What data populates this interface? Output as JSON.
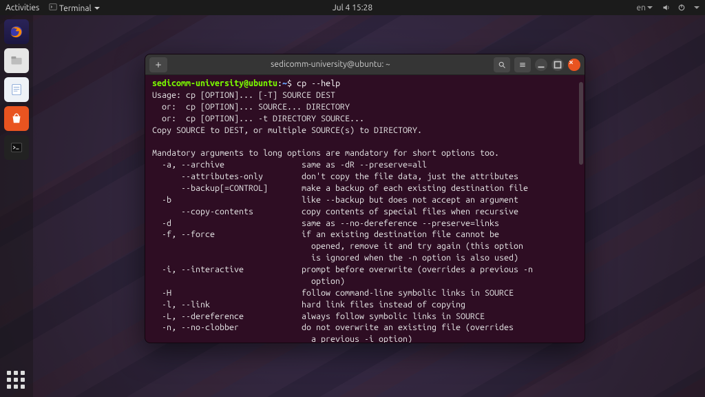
{
  "topbar": {
    "activities": "Activities",
    "app_menu": "Terminal",
    "clock": "Jul 4  15:28",
    "lang": "en"
  },
  "dock": {
    "items": [
      {
        "name": "firefox"
      },
      {
        "name": "files"
      },
      {
        "name": "writer"
      },
      {
        "name": "software"
      },
      {
        "name": "terminal"
      }
    ]
  },
  "terminal": {
    "window_title": "sedicomm-university@ubuntu: ~",
    "prompt_user": "sedicomm-university@ubuntu",
    "prompt_path": "~",
    "prompt_sep": ":",
    "prompt_end": "$ ",
    "command": "cp --help",
    "output": "Usage: cp [OPTION]... [-T] SOURCE DEST\n  or:  cp [OPTION]... SOURCE... DIRECTORY\n  or:  cp [OPTION]... -t DIRECTORY SOURCE...\nCopy SOURCE to DEST, or multiple SOURCE(s) to DIRECTORY.\n\nMandatory arguments to long options are mandatory for short options too.\n  -a, --archive                same as -dR --preserve=all\n      --attributes-only        don't copy the file data, just the attributes\n      --backup[=CONTROL]       make a backup of each existing destination file\n  -b                           like --backup but does not accept an argument\n      --copy-contents          copy contents of special files when recursive\n  -d                           same as --no-dereference --preserve=links\n  -f, --force                  if an existing destination file cannot be\n                                 opened, remove it and try again (this option\n                                 is ignored when the -n option is also used)\n  -i, --interactive            prompt before overwrite (overrides a previous -n\n                                 option)\n  -H                           follow command-line symbolic links in SOURCE\n  -l, --link                   hard link files instead of copying\n  -L, --dereference            always follow symbolic links in SOURCE\n  -n, --no-clobber             do not overwrite an existing file (overrides\n                                 a previous -i option)\n  -P, --no-dereference         never follow symbolic links in SOURCE\n  -p                           same as --preserve=mode,ownership,timestamps\n      --preserve[=ATTR_LIST]   preserve the specified attributes (default:"
  }
}
